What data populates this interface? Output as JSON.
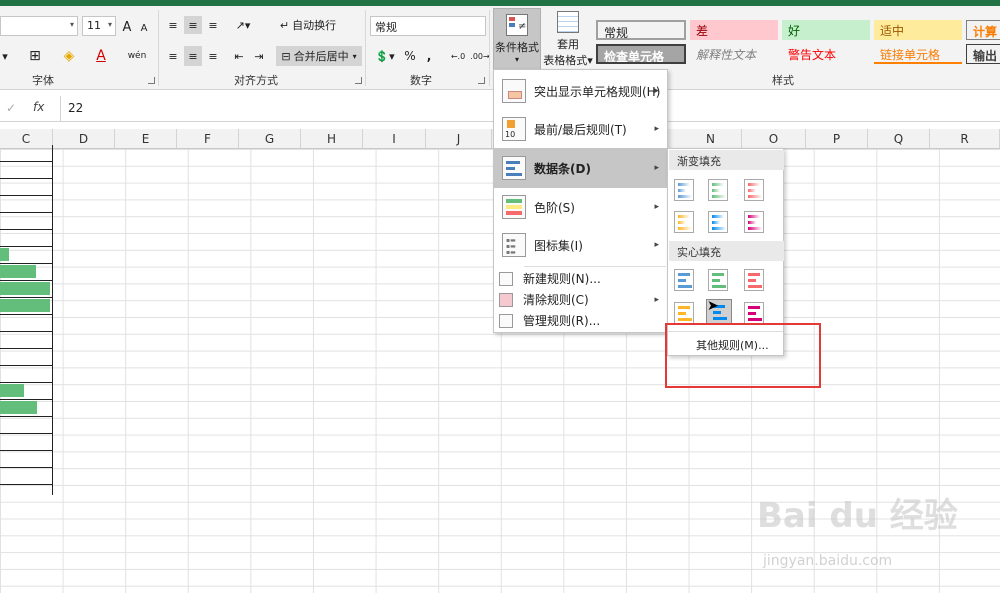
{
  "ribbon": {
    "font": {
      "size_value": "11",
      "group_label": "字体",
      "grow_icon": "A",
      "shrink_icon": "A",
      "border_icon": "⊞",
      "fill_icon": "◈",
      "font_color_icon": "A",
      "wen_icon": "wén"
    },
    "alignment": {
      "group_label": "对齐方式",
      "wrap_label": "自动换行",
      "merge_label": "合并后居中"
    },
    "number": {
      "group_label": "数字",
      "format_value": "常规",
      "percent_label": "%",
      "comma_label": ",",
      "inc_label": "←.0",
      "dec_label": ".00→"
    },
    "styles": {
      "group_label": "样式",
      "cond_format_label": "条件格式",
      "table_format_label_1": "套用",
      "table_format_label_2": "表格格式",
      "cells": [
        {
          "label": "常规",
          "bg": "#ffffff",
          "color": "#000000"
        },
        {
          "label": "差",
          "bg": "#ffc7ce",
          "color": "#9c0006"
        },
        {
          "label": "好",
          "bg": "#c6efce",
          "color": "#006100"
        },
        {
          "label": "适中",
          "bg": "#ffeb9c",
          "color": "#9c5700"
        },
        {
          "label": "计算",
          "bg": "#f2f2f2",
          "color": "#fa7d00"
        },
        {
          "label": "检查单元格",
          "bg": "#a5a5a5",
          "color": "#ffffff"
        },
        {
          "label": "解释性文本",
          "bg": "#ffffff",
          "color": "#7f7f7f"
        },
        {
          "label": "警告文本",
          "bg": "#ffffff",
          "color": "#ff0000"
        },
        {
          "label": "链接单元格",
          "bg": "#ffffff",
          "color": "#fa7d00"
        },
        {
          "label": "输出",
          "bg": "#f2f2f2",
          "color": "#3f3f3f"
        }
      ]
    }
  },
  "formula_bar": {
    "cancel_icon": "✓",
    "fx_label": "fx",
    "value": "22"
  },
  "columns": [
    "C",
    "D",
    "E",
    "F",
    "G",
    "H",
    "I",
    "J",
    "N",
    "O",
    "P",
    "Q",
    "R"
  ],
  "menu": {
    "items": [
      {
        "label": "突出显示单元格规则(H)",
        "has_arrow": true
      },
      {
        "label": "最前/最后规则(T)",
        "has_arrow": true
      },
      {
        "label": "数据条(D)",
        "has_arrow": true
      },
      {
        "label": "色阶(S)",
        "has_arrow": true
      },
      {
        "label": "图标集(I)",
        "has_arrow": true
      },
      {
        "label": "新建规则(N)...",
        "has_arrow": false
      },
      {
        "label": "清除规则(C)",
        "has_arrow": true
      },
      {
        "label": "管理规则(R)...",
        "has_arrow": false
      }
    ]
  },
  "submenu": {
    "gradient_label": "渐变填充",
    "solid_label": "实心填充",
    "other_rules_label": "其他规则(M)..."
  },
  "icons": {
    "cond_format_icon": "conditional-format-icon",
    "arrow_right": "▸",
    "dropdown": "▾"
  },
  "colors": {
    "excel_green": "#217346",
    "data_bar_green": "#63be7b",
    "highlight_red": "#e53935"
  },
  "watermark": {
    "brand": "Bai du 经验",
    "url": "jingyan.baidu.com"
  }
}
